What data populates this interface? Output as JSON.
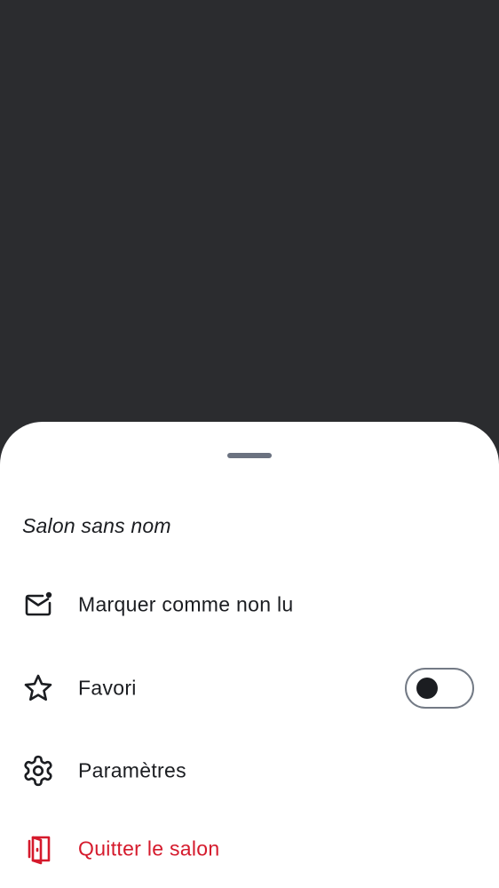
{
  "sheet": {
    "title": "Salon sans nom",
    "items": [
      {
        "label": "Marquer comme non lu",
        "icon": "mark-unread-icon"
      },
      {
        "label": "Favori",
        "icon": "star-icon",
        "toggle": {
          "on": false
        }
      },
      {
        "label": "Paramètres",
        "icon": "settings-gear-icon"
      },
      {
        "label": "Quitter le salon",
        "icon": "leave-door-icon",
        "color": "#d51a2c"
      }
    ]
  },
  "colors": {
    "scrim": "#2b2c2f",
    "text": "#1b1d21",
    "danger": "#d51a2c",
    "handle": "#6b7280"
  }
}
